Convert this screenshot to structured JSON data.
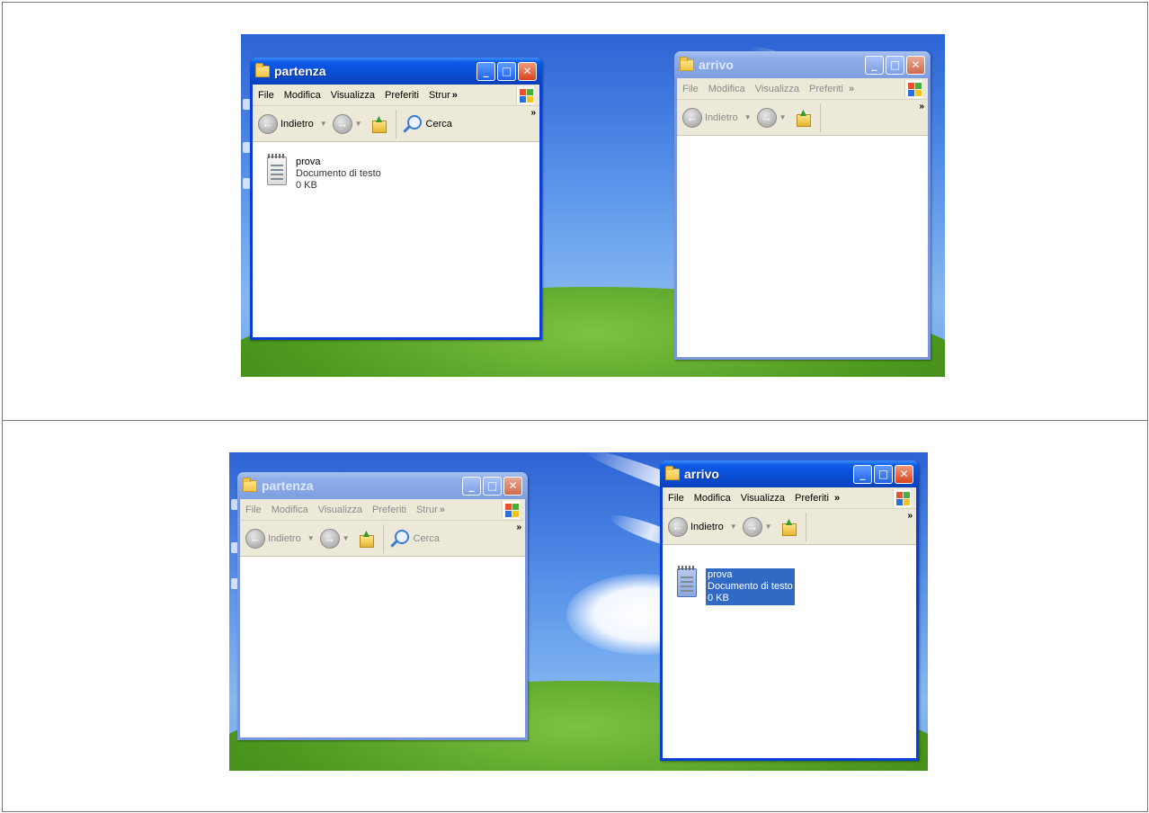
{
  "top": {
    "left_window": {
      "title": "partenza",
      "menu": [
        "File",
        "Modifica",
        "Visualizza",
        "Preferiti",
        "Strur"
      ],
      "menu_more": "»",
      "toolbar": {
        "back": "Indietro",
        "search": "Cerca",
        "more": "»"
      },
      "files": [
        {
          "name": "prova",
          "type": "Documento di testo",
          "size": "0 KB"
        }
      ]
    },
    "right_window": {
      "title": "arrivo",
      "menu": [
        "File",
        "Modifica",
        "Visualizza",
        "Preferiti"
      ],
      "menu_more": "»",
      "toolbar": {
        "back": "Indietro",
        "more": "»"
      },
      "files": []
    }
  },
  "bottom": {
    "left_window": {
      "title": "partenza",
      "menu": [
        "File",
        "Modifica",
        "Visualizza",
        "Preferiti",
        "Strur"
      ],
      "menu_more": "»",
      "toolbar": {
        "back": "Indietro",
        "search": "Cerca",
        "more": "»"
      },
      "files": []
    },
    "right_window": {
      "title": "arrivo",
      "menu": [
        "File",
        "Modifica",
        "Visualizza",
        "Preferiti"
      ],
      "menu_more": "»",
      "toolbar": {
        "back": "Indietro",
        "more": "»"
      },
      "files": [
        {
          "name": "prova",
          "type": "Documento di testo",
          "size": "0 KB",
          "selected": true
        }
      ]
    }
  },
  "icons": {
    "window_controls": [
      "minimize-icon",
      "maximize-icon",
      "close-icon"
    ],
    "nav": [
      "back-arrow-icon",
      "forward-arrow-icon",
      "folder-up-icon",
      "search-icon"
    ]
  },
  "colors": {
    "active_titlebar": "#0a4fd6",
    "inactive_titlebar": "#87a7e6",
    "selection": "#316ac5",
    "window_body": "#ece9d8"
  }
}
